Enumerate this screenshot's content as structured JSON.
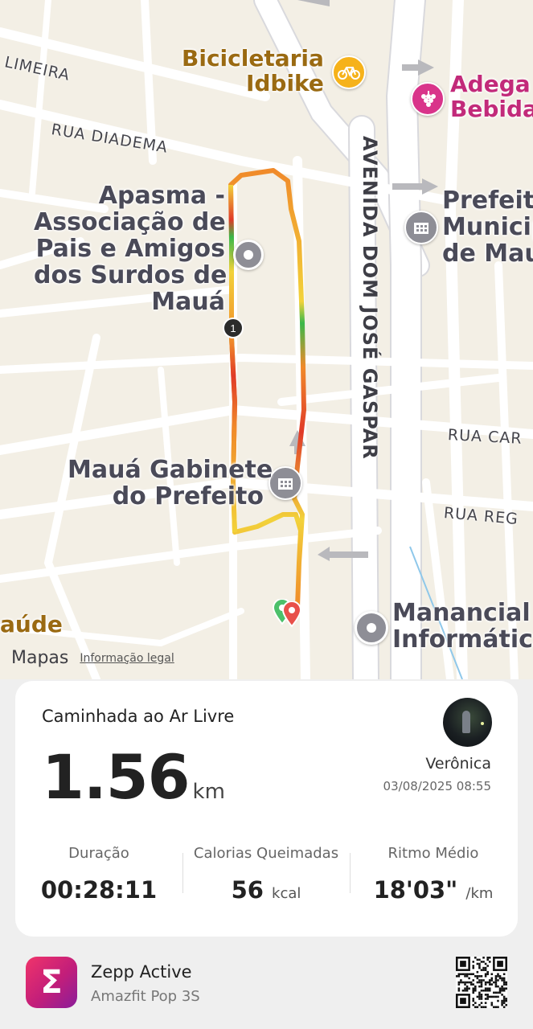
{
  "map": {
    "pois": {
      "bicicletaria": "Bicicletaria\nIdbike",
      "adega": "Adega\nBebida",
      "apasma": "Apasma -\nAssociação de\nPais e Amigos\ndos Surdos de\nMauá",
      "prefeitura": "Prefeitu\nMunicip\nde Mau",
      "gabinete": "Mauá Gabinete\ndo Prefeito",
      "manancial": "Manancial\nInformática",
      "saude": "aúde"
    },
    "streets": {
      "limeira": "LIMEIRA",
      "diadema": "RUA DIADEMA",
      "avenida": "AVENIDA DOM JOSÉ GASPAR",
      "rua_car": "RUA CAR",
      "rua_reg": "RUA REG"
    },
    "lap_marker": "1",
    "attribution": "Mapas",
    "legal": "Informação legal"
  },
  "card": {
    "activity": "Caminhada ao Ar Livre",
    "distance": "1.56",
    "distance_unit": "km",
    "user": "Verônica",
    "datetime": "03/08/2025 08:55",
    "stats": [
      {
        "label": "Duração",
        "value": "00:28:11",
        "unit": ""
      },
      {
        "label": "Calorias Queimadas",
        "value": "56",
        "unit": "kcal"
      },
      {
        "label": "Ritmo Médio",
        "value": "18'03\"",
        "unit": "/km"
      }
    ]
  },
  "footer": {
    "app_name": "Zepp Active",
    "device": "Amazfit Pop 3S",
    "logo_glyph": "Σ"
  },
  "colors": {
    "route_yellow": "#f2d23a",
    "route_orange": "#f08a2a",
    "route_red": "#e03a28",
    "route_green": "#3ab84a",
    "card_bg": "#ffffff",
    "map_bg": "#f3efe5"
  },
  "icons": {
    "bike": "bicycle-icon",
    "wine": "wine-icon",
    "building": "building-icon",
    "pin": "map-pin-icon",
    "apple": "apple-icon"
  }
}
